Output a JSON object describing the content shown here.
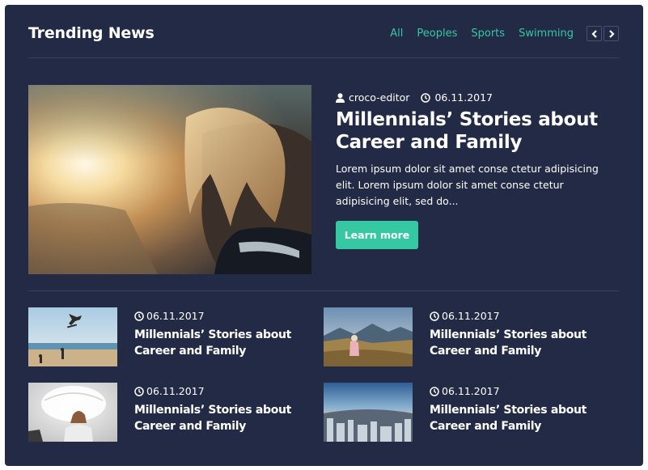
{
  "header": {
    "title": "Trending News",
    "filters": [
      "All",
      "Peoples",
      "Sports",
      "Swimming"
    ]
  },
  "colors": {
    "background": "#232a45",
    "accent": "#35c8a3",
    "text": "#ffffff",
    "divider": "#3a4160"
  },
  "featured": {
    "author": "croco-editor",
    "date": "06.11.2017",
    "title": "Millennials’ Stories about Career and Family",
    "excerpt": "Lorem ipsum dolor sit amet conse ctetur adipisicing elit. Lorem ipsum dolor sit amet conse ctetur adipisicing elit, sed do...",
    "button_label": "Learn more"
  },
  "items": [
    {
      "date": "06.11.2017",
      "title": "Millennials’ Stories about Career and Family"
    },
    {
      "date": "06.11.2017",
      "title": "Millennials’ Stories about Career and Family"
    },
    {
      "date": "06.11.2017",
      "title": "Millennials’ Stories about Career and Family"
    },
    {
      "date": "06.11.2017",
      "title": "Millennials’ Stories about Career and Family"
    }
  ],
  "icons": {
    "author": "user-icon",
    "date": "clock-icon",
    "prev": "chevron-left-icon",
    "next": "chevron-right-icon"
  }
}
